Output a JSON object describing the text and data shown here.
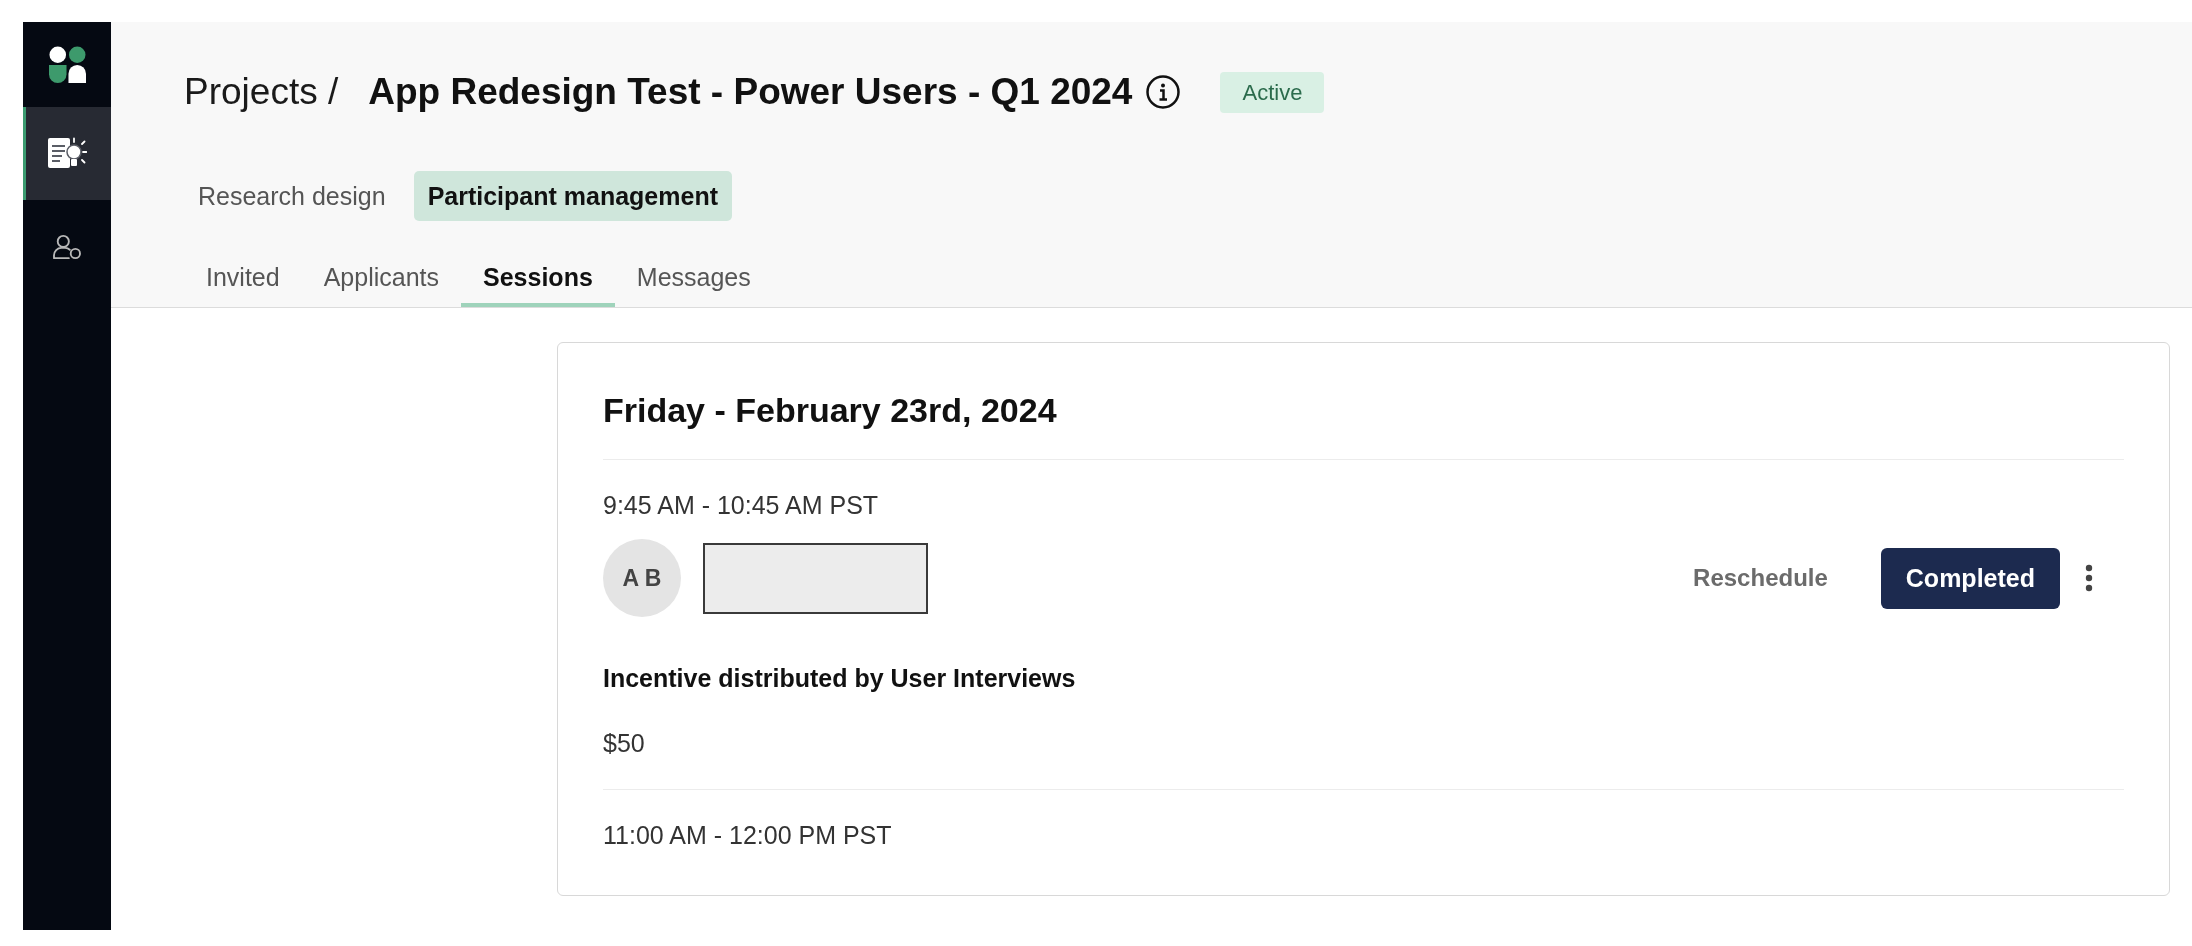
{
  "sidebar": {
    "items": [
      {
        "selected": true
      },
      {
        "selected": false
      }
    ]
  },
  "header": {
    "breadcrumb": "Projects /",
    "title": "App Redesign Test - Power Users - Q1 2024",
    "status": "Active"
  },
  "section_tabs": [
    {
      "label": "Research design",
      "selected": false
    },
    {
      "label": "Participant management",
      "selected": true
    }
  ],
  "tabs": [
    {
      "label": "Invited",
      "selected": false
    },
    {
      "label": "Applicants",
      "selected": false
    },
    {
      "label": "Sessions",
      "selected": true
    },
    {
      "label": "Messages",
      "selected": false
    }
  ],
  "schedule": {
    "date": "Friday - February 23rd, 2024",
    "sessions": [
      {
        "time": "9:45 AM - 10:45 AM PST",
        "participant": {
          "initials": "A B",
          "name_redacted": true
        },
        "reschedule": "Reschedule",
        "status": "Completed",
        "incentive_label": "Incentive distributed by User Interviews",
        "incentive_amount": "$50"
      },
      {
        "time": "11:00 AM - 12:00 PM PST"
      }
    ]
  }
}
